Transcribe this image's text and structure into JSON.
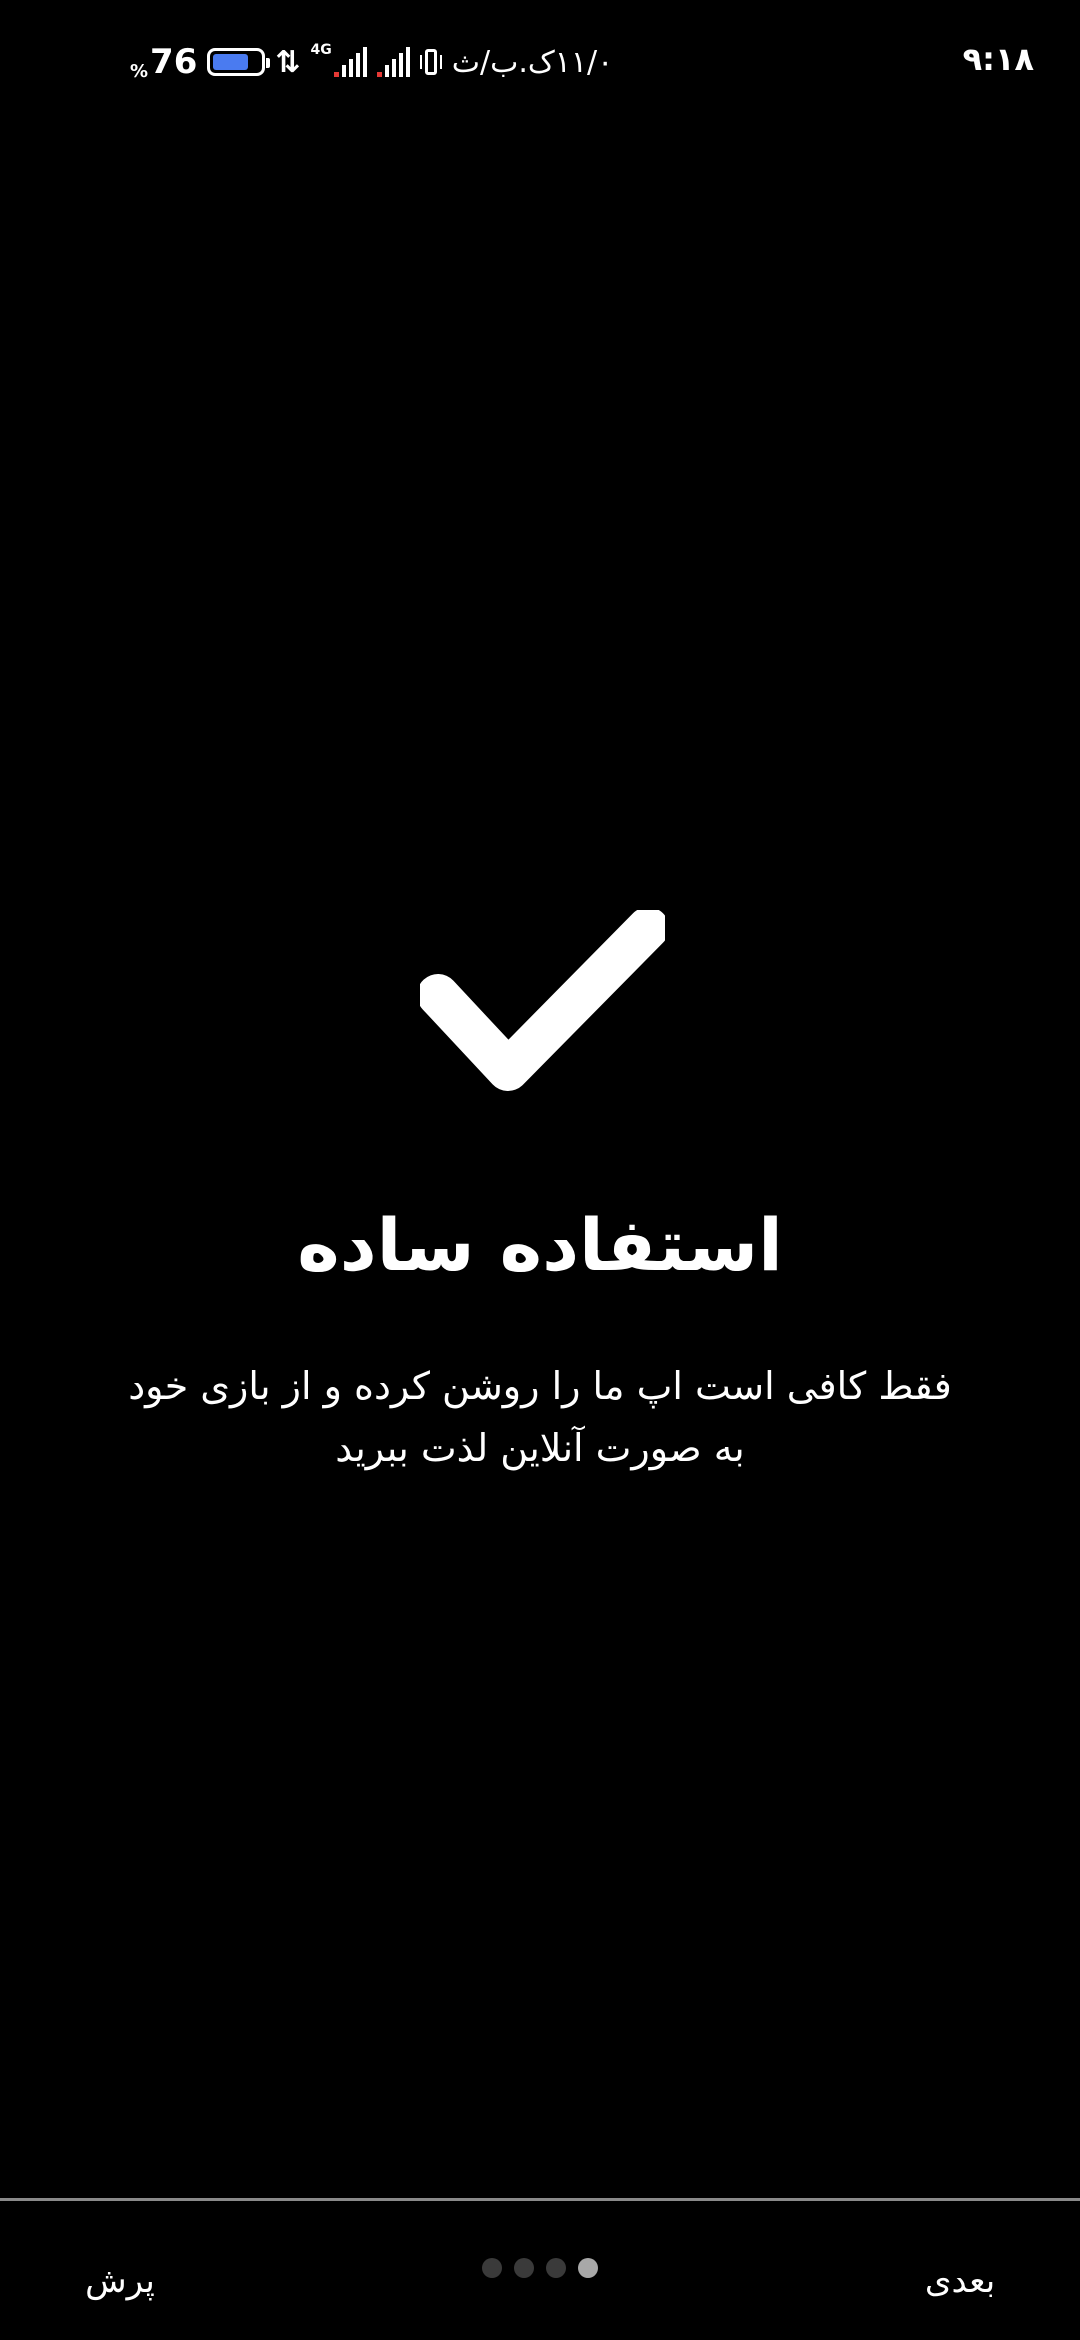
{
  "status_bar": {
    "clock": "۹:۱۸",
    "battery_percent": "76",
    "battery_percent_sign": "%",
    "battery_level": 0.76,
    "network_type": "4G",
    "data_arrows": "⇅",
    "network_speed": "۱۱/۰ک.ب/ث",
    "icons": [
      "battery-icon",
      "data-activity-icon",
      "signal-icon",
      "signal-icon",
      "vibrate-icon"
    ]
  },
  "main": {
    "icon": "checkmark-icon",
    "title": "استفاده ساده",
    "description": "فقط کافی است اپ ما را روشن کرده و از بازی خود به صورت آنلاین لذت ببرید"
  },
  "bottom_nav": {
    "skip_label": "پرش",
    "next_label": "بعدی",
    "page_count": 4,
    "active_page_index": 3
  },
  "colors": {
    "background": "#000000",
    "text": "#ffffff",
    "battery_fill": "#4a7bf0",
    "signal_alert": "#e53935",
    "dot_inactive": "#3a3a3a",
    "dot_active": "#a8a8a8",
    "divider": "#8a8a8a"
  }
}
